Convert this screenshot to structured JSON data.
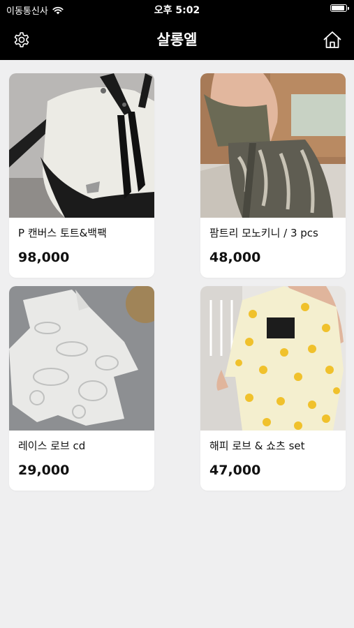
{
  "status_bar": {
    "carrier": "이동통신사",
    "time": "오후 5:02",
    "battery_level": 0.95
  },
  "nav": {
    "title": "살롱엘",
    "settings_icon": "gear-icon",
    "home_icon": "home-icon"
  },
  "products": [
    {
      "name": "P 캔버스 토트&백팩",
      "price": "98,000",
      "image": "white-black-bucket-bag-photo"
    },
    {
      "name": "팜트리 모노키니 / 3 pcs",
      "price": "48,000",
      "image": "monokini-set-photo"
    },
    {
      "name": "레이스 로브 cd",
      "price": "29,000",
      "image": "white-lace-robe-photo"
    },
    {
      "name": "해피 로브 & 쇼츠 set",
      "price": "47,000",
      "image": "smiley-robe-shorts-photo"
    }
  ]
}
